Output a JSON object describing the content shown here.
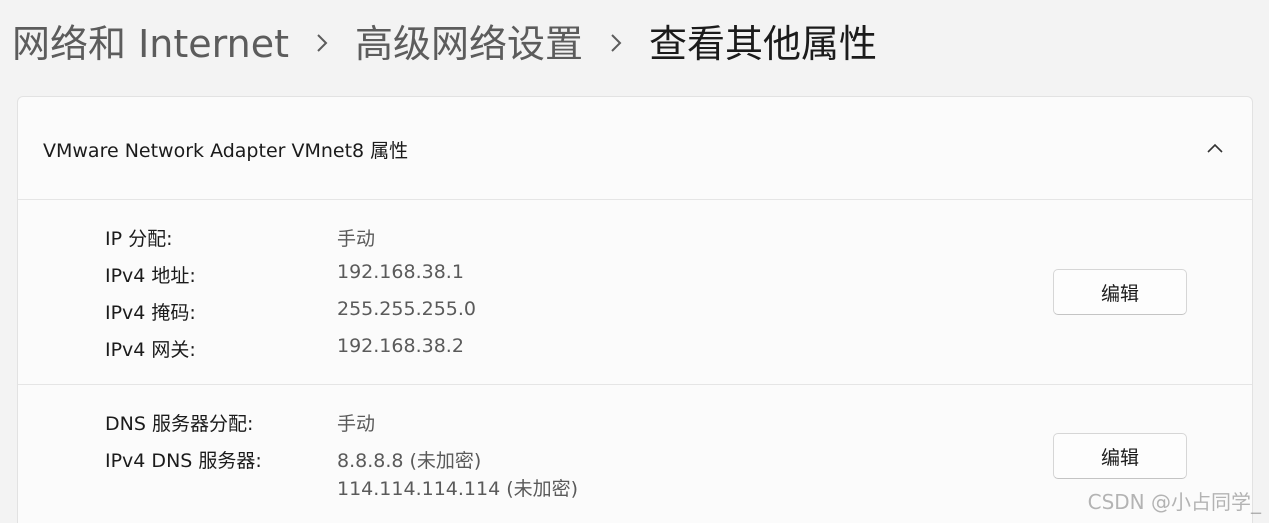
{
  "breadcrumb": {
    "items": [
      {
        "label": "网络和 Internet"
      },
      {
        "label": "高级网络设置"
      },
      {
        "label": "查看其他属性"
      }
    ]
  },
  "card": {
    "title": "VMware Network Adapter VMnet8 属性",
    "collapse_icon": "chevron-up-icon",
    "ip_section": {
      "rows": [
        {
          "label": "IP 分配:",
          "value": "手动"
        },
        {
          "label": "IPv4 地址:",
          "value": "192.168.38.1"
        },
        {
          "label": "IPv4 掩码:",
          "value": "255.255.255.0"
        },
        {
          "label": "IPv4 网关:",
          "value": "192.168.38.2"
        }
      ],
      "edit_label": "编辑"
    },
    "dns_section": {
      "assignment_label": "DNS 服务器分配:",
      "assignment_value": "手动",
      "servers_label": "IPv4 DNS 服务器:",
      "servers": [
        "8.8.8.8 (未加密)",
        "114.114.114.114 (未加密)"
      ],
      "edit_label": "编辑"
    }
  },
  "watermark": "CSDN @小占同学_",
  "colors": {
    "background": "#f3f3f3",
    "card": "#fbfbfb",
    "text": "#1b1b1b",
    "secondary_text": "#5a5a5a"
  }
}
